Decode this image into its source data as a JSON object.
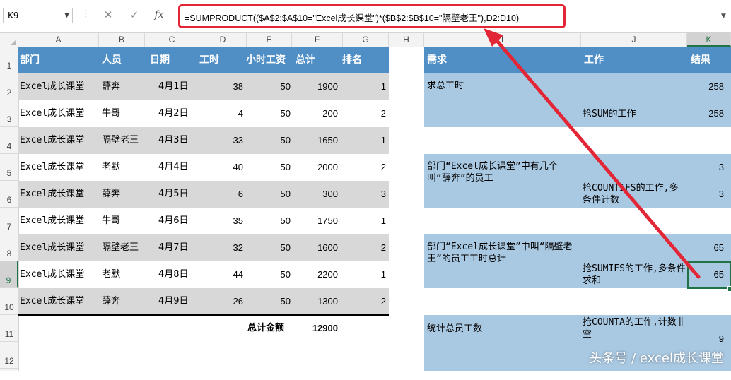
{
  "formula_bar": {
    "name_box": "K9",
    "cancel_glyph": "✕",
    "enter_glyph": "✓",
    "fx_label": "fx",
    "formula": "=SUMPRODUCT(($A$2:$A$10=\"Excel成长课堂\")*($B$2:$B$10=\"隔壁老王\"),D2:D10)"
  },
  "columns": [
    "A",
    "B",
    "C",
    "D",
    "E",
    "F",
    "G",
    "H",
    "I",
    "J",
    "K"
  ],
  "selected_column": "K",
  "rows": [
    "1",
    "2",
    "3",
    "4",
    "5",
    "6",
    "7",
    "8",
    "9",
    "10",
    "11",
    "12"
  ],
  "selected_row": "9",
  "left_table": {
    "headers": [
      "部门",
      "人员",
      "日期",
      "工时",
      "小时工资",
      "总计",
      "排名"
    ],
    "rows": [
      [
        "Excel成长课堂",
        "薛奔",
        "4月1日",
        "38",
        "50",
        "1900",
        "1"
      ],
      [
        "Excel成长课堂",
        "牛哥",
        "4月2日",
        "4",
        "50",
        "200",
        "2"
      ],
      [
        "Excel成长课堂",
        "隔壁老王",
        "4月3日",
        "33",
        "50",
        "1650",
        "1"
      ],
      [
        "Excel成长课堂",
        "老默",
        "4月4日",
        "40",
        "50",
        "2000",
        "2"
      ],
      [
        "Excel成长课堂",
        "薛奔",
        "4月5日",
        "6",
        "50",
        "300",
        "3"
      ],
      [
        "Excel成长课堂",
        "牛哥",
        "4月6日",
        "35",
        "50",
        "1750",
        "1"
      ],
      [
        "Excel成长课堂",
        "隔壁老王",
        "4月7日",
        "32",
        "50",
        "1600",
        "2"
      ],
      [
        "Excel成长课堂",
        "老默",
        "4月8日",
        "44",
        "50",
        "2200",
        "1"
      ],
      [
        "Excel成长课堂",
        "薛奔",
        "4月9日",
        "26",
        "50",
        "1300",
        "2"
      ]
    ],
    "total_label": "总计金额",
    "total_value": "12900"
  },
  "right_table": {
    "headers": [
      "需求",
      "工作",
      "结果"
    ],
    "blocks": [
      {
        "need": "求总工时",
        "items": [
          {
            "work": "",
            "result": "258"
          },
          {
            "work": "抢SUM的工作",
            "result": "258"
          }
        ]
      },
      {
        "need": "部门“Excel成长课堂”中有几个叫“薛奔”的员工",
        "items": [
          {
            "work": "",
            "result": "3"
          },
          {
            "work": "抢COUNTIFS的工作,多条件计数",
            "result": "3"
          }
        ]
      },
      {
        "need": "部门“Excel成长课堂”中叫“隔壁老王”的员工工时总计",
        "items": [
          {
            "work": "",
            "result": "65"
          },
          {
            "work": "抢SUMIFS的工作,多条件求和",
            "result": "65"
          }
        ]
      },
      {
        "need": "统计总员工数",
        "items": [
          {
            "work": "抢COUNTA的工作,计数非空",
            "result": "9"
          }
        ]
      }
    ]
  },
  "watermark": "头条号 / excel成长课堂",
  "colors": {
    "header_blue": "#4f8fc6",
    "light_blue": "#a9c8e2",
    "row_gray": "#d8d8d8",
    "highlight_red": "#e32636",
    "excel_green": "#217346"
  }
}
